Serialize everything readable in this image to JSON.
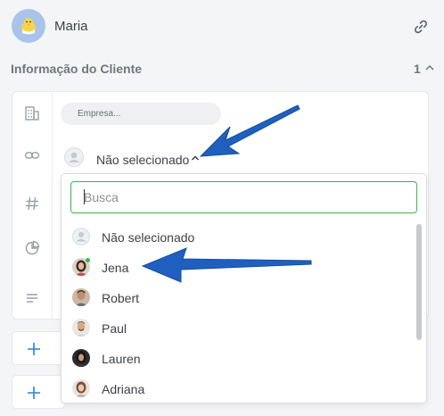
{
  "header": {
    "user_name": "Maria",
    "avatar_icon": "chick-icon",
    "link_icon": "link-icon"
  },
  "section": {
    "title": "Informação do Cliente",
    "count": "1",
    "chevron_icon": "chevron-up-icon"
  },
  "form": {
    "empresa_placeholder": "Empresa...",
    "row_icons": [
      "building-icon",
      "link-icon",
      "hash-icon",
      "pie-chart-icon",
      "lines-icon"
    ],
    "selector_label": "Não selecionado"
  },
  "dropdown": {
    "search_placeholder": "Busca",
    "search_value": "",
    "options": [
      {
        "label": "Não selecionado",
        "avatar": "placeholder-avatar",
        "online": false
      },
      {
        "label": "Jena",
        "avatar": "photo",
        "online": true
      },
      {
        "label": "Robert",
        "avatar": "photo",
        "online": false
      },
      {
        "label": "Paul",
        "avatar": "photo",
        "online": false
      },
      {
        "label": "Lauren",
        "avatar": "photo",
        "online": false
      },
      {
        "label": "Adriana",
        "avatar": "photo",
        "online": false
      }
    ]
  },
  "colors": {
    "accent_green": "#3ab54a",
    "arrow_blue": "#1f5fbf",
    "plus_blue": "#2f7fd3"
  }
}
